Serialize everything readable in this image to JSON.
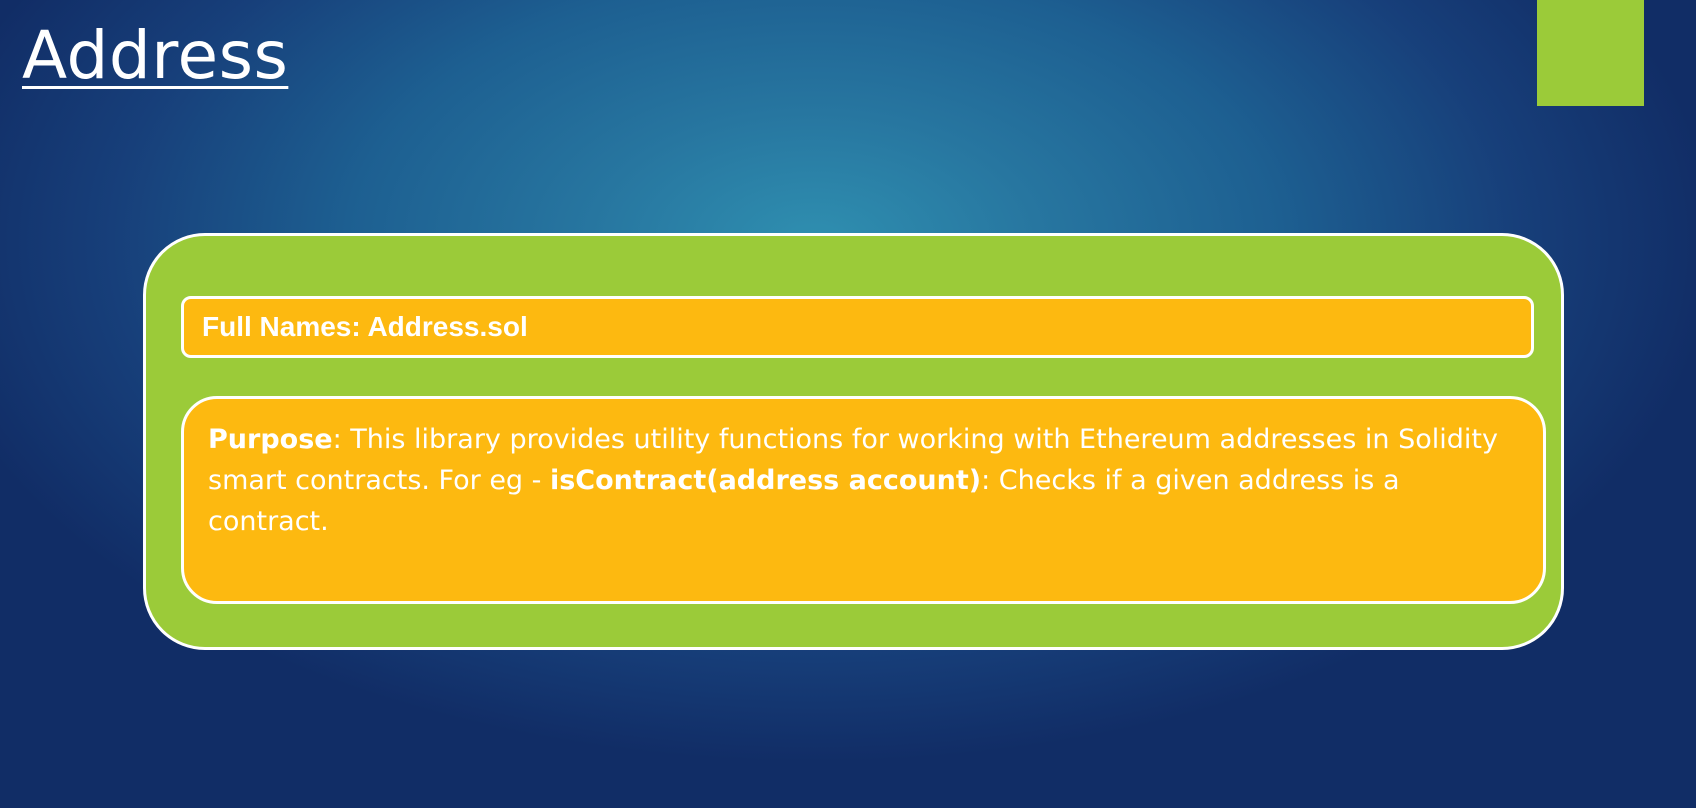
{
  "slide": {
    "title": "Address"
  },
  "full_names": {
    "label": "Full Names: Address.sol"
  },
  "purpose": {
    "label": "Purpose",
    "text_1": ": This library provides utility functions for working with Ethereum addresses in Solidity smart contracts. For eg - ",
    "function_signature": "isContract(address account)",
    "text_2": ": Checks if a given address is a contract."
  },
  "colors": {
    "background_center": "#2f8fb0",
    "background_edge": "#112d66",
    "panel_green": "#9bcb39",
    "box_orange": "#fdb910",
    "text_white": "#ffffff"
  }
}
